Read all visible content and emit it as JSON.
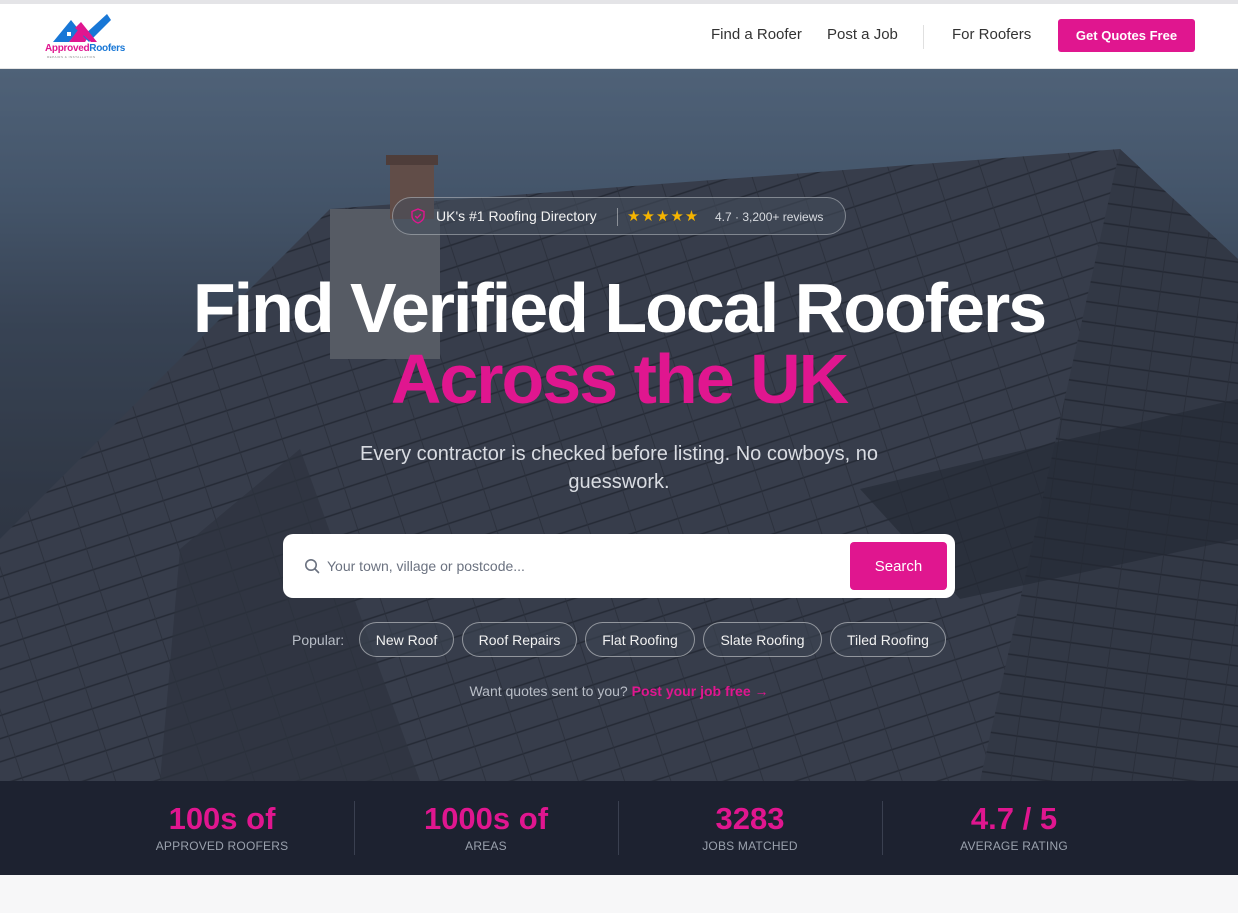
{
  "brand": {
    "logo_part1": "Approved",
    "logo_part2": "Roofers",
    "tagline": "REPAIRS & INSTALLATION",
    "colors": {
      "pink": "#e0168f",
      "blue": "#1877d6"
    }
  },
  "nav": {
    "links": [
      "Find a Roofer",
      "Post a Job",
      "For Roofers"
    ],
    "cta": "Get Quotes Free"
  },
  "badge": {
    "text": "UK's #1 Roofing Directory",
    "stars": "★★★★★",
    "rating": "4.7 · 3,200+ reviews"
  },
  "hero": {
    "title_line1": "Find Verified Local Roofers",
    "title_line2": "Across the UK",
    "subtitle": "Every contractor is checked before listing. No cowboys, no guesswork."
  },
  "search": {
    "placeholder": "Your town, village or postcode...",
    "button": "Search"
  },
  "popular": {
    "label": "Popular:",
    "chips": [
      "New Roof",
      "Roof Repairs",
      "Flat Roofing",
      "Slate Roofing",
      "Tiled Roofing"
    ]
  },
  "post_job": {
    "text": "Want quotes sent to you?",
    "link": "Post your job free →"
  },
  "stats": [
    {
      "value": "100s of",
      "label": "Approved Roofers"
    },
    {
      "value": "1000s of",
      "label": "Areas"
    },
    {
      "value": "3283",
      "label": "Jobs Matched"
    },
    {
      "value": "4.7 / 5",
      "label": "Average Rating"
    }
  ]
}
